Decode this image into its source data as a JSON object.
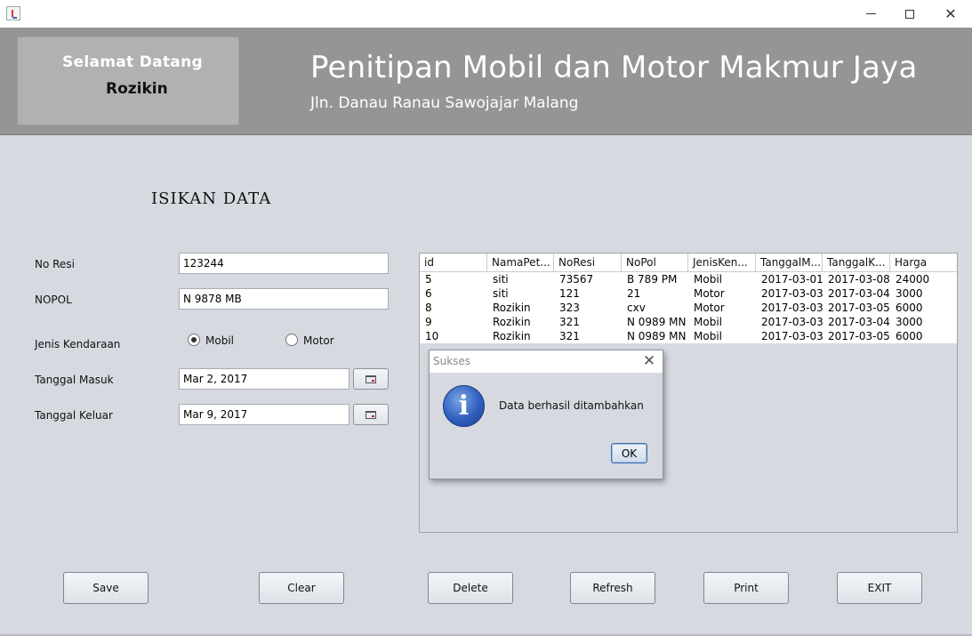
{
  "window": {
    "min_glyph": "",
    "close_glyph": "✕"
  },
  "header": {
    "welcome": "Selamat Datang",
    "user_name": "Rozikin",
    "title": "Penitipan Mobil dan Motor Makmur Jaya",
    "address": "Jln. Danau Ranau Sawojajar Malang"
  },
  "form": {
    "section_title": "ISIKAN DATA",
    "no_resi_label": "No Resi",
    "no_resi_value": "123244",
    "nopol_label": "NOPOL",
    "nopol_value": "N 9878 MB",
    "jenis_label": "Jenis Kendaraan",
    "radio_mobil": "Mobil",
    "radio_motor": "Motor",
    "selected": "Mobil",
    "tgl_masuk_label": "Tanggal Masuk",
    "tgl_masuk_value": "Mar 2, 2017",
    "tgl_keluar_label": "Tanggal Keluar",
    "tgl_keluar_value": "Mar 9, 2017"
  },
  "table": {
    "columns": [
      "id",
      "NamaPet...",
      "NoResi",
      "NoPol",
      "JenisKen...",
      "TanggalM...",
      "TanggalK...",
      "Harga"
    ],
    "rows": [
      [
        "5",
        "siti",
        "73567",
        "B 789 PM",
        "Mobil",
        "2017-03-01",
        "2017-03-08",
        "24000"
      ],
      [
        "6",
        "siti",
        "121",
        "21",
        "Motor",
        "2017-03-03",
        "2017-03-04",
        "3000"
      ],
      [
        "8",
        "Rozikin",
        "323",
        "cxv",
        "Motor",
        "2017-03-03",
        "2017-03-05",
        "6000"
      ],
      [
        "9",
        "Rozikin",
        "321",
        "N 0989 MN",
        "Mobil",
        "2017-03-03",
        "2017-03-04",
        "3000"
      ],
      [
        "10",
        "Rozikin",
        "321",
        "N 0989 MN",
        "Mobil",
        "2017-03-03",
        "2017-03-05",
        "6000"
      ]
    ]
  },
  "dialog": {
    "title": "Sukses",
    "close": "✕",
    "icon_letter": "i",
    "message": "Data berhasil ditambahkan",
    "ok_label": "OK"
  },
  "buttons": {
    "save": "Save",
    "clear": "Clear",
    "delete": "Delete",
    "refresh": "Refresh",
    "print": "Print",
    "exit": "EXIT"
  },
  "colors": {
    "header_bg": "#959595",
    "welcome_box": "#b3b0b0",
    "panel_bg": "#d6d9e0",
    "info_blue": "#2f5fbd"
  }
}
